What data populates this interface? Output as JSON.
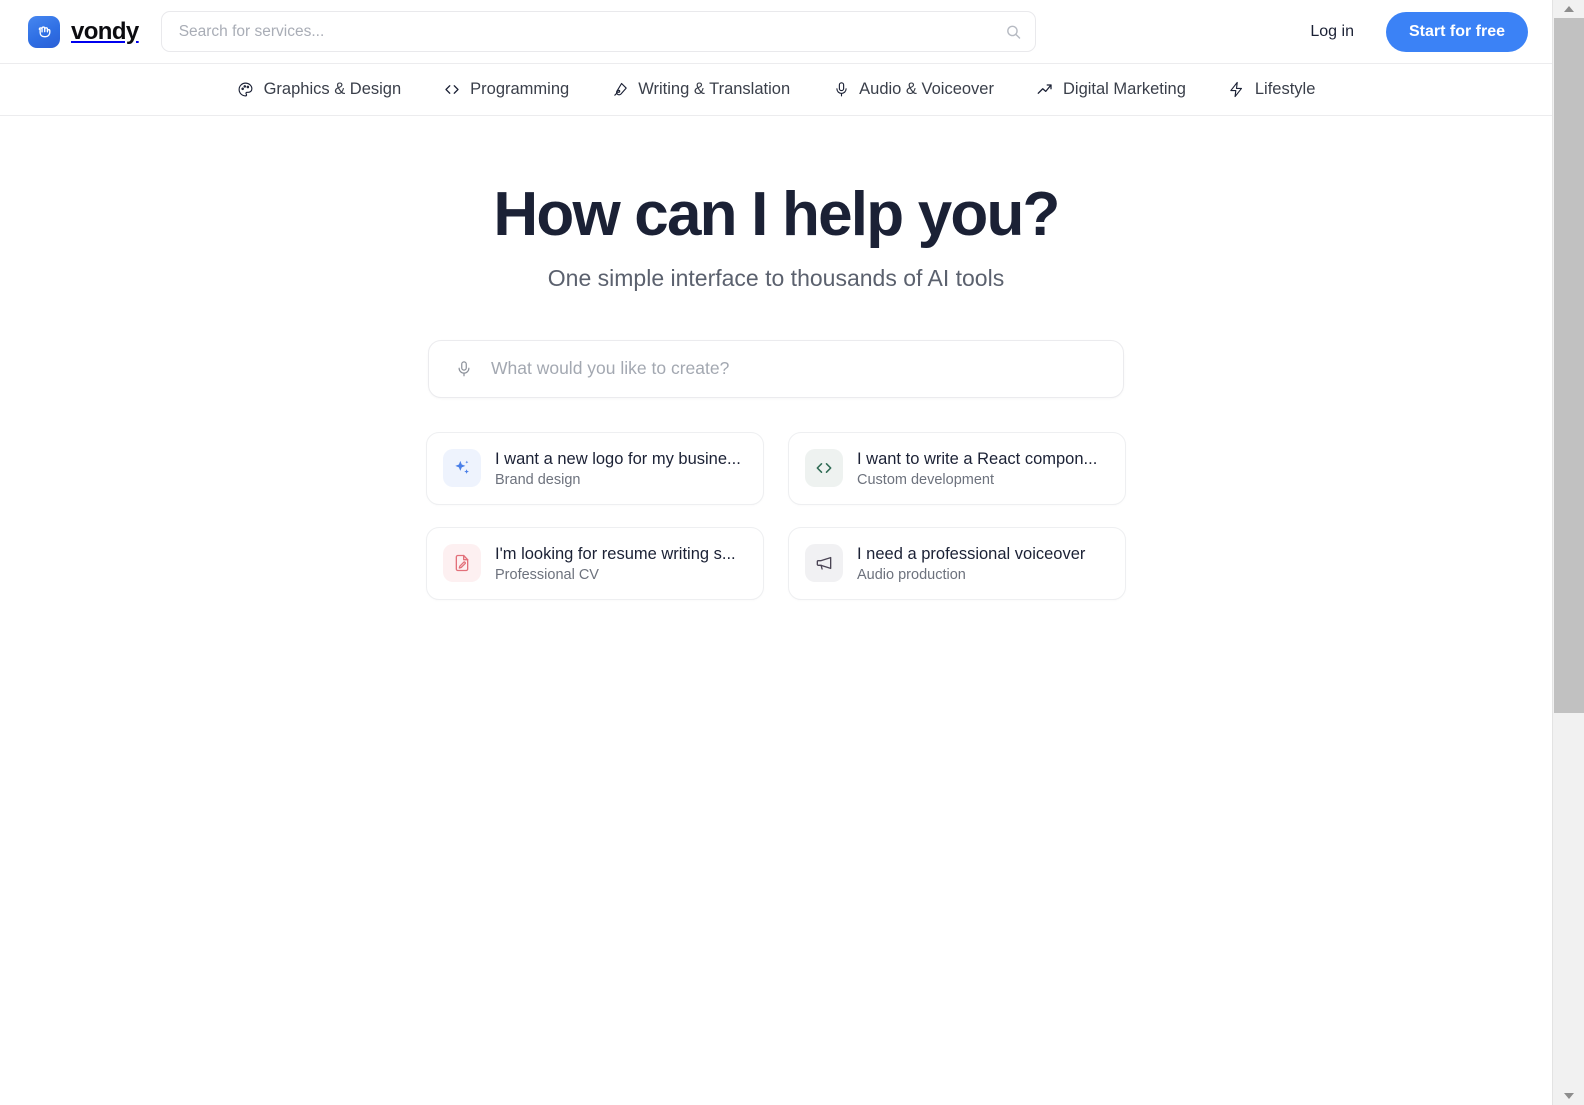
{
  "header": {
    "brand_name": "vondy",
    "brand_icon": "shaka-hand-icon",
    "search": {
      "placeholder": "Search for services...",
      "value": "",
      "icon": "search-icon"
    },
    "login_label": "Log in",
    "cta_label": "Start for free",
    "cta_color": "#3b82f6"
  },
  "nav": {
    "items": [
      {
        "label": "Graphics & Design",
        "icon": "palette-icon"
      },
      {
        "label": "Programming",
        "icon": "code-brackets-icon"
      },
      {
        "label": "Writing & Translation",
        "icon": "pen-nib-icon"
      },
      {
        "label": "Audio & Voiceover",
        "icon": "microphone-icon"
      },
      {
        "label": "Digital Marketing",
        "icon": "trending-up-icon"
      },
      {
        "label": "Lifestyle",
        "icon": "lightning-bolt-icon"
      }
    ]
  },
  "hero": {
    "title": "How can I help you?",
    "subtitle": "One simple interface to thousands of AI tools",
    "title_color": "#1b2135",
    "subtitle_color": "#5b616e"
  },
  "prompt": {
    "placeholder": "What would you like to create?",
    "value": "",
    "icon": "microphone-icon"
  },
  "suggestions": [
    {
      "title": "I want a new logo for my busine...",
      "subtitle": "Brand design",
      "icon": "sparkles-icon",
      "icon_color": "#4a7fe8",
      "icon_bg": "#eef3fd"
    },
    {
      "title": "I want to write a React compon...",
      "subtitle": "Custom development",
      "icon": "code-brackets-icon",
      "icon_color": "#2f6b54",
      "icon_bg": "#eef2f0"
    },
    {
      "title": "I'm looking for resume writing s...",
      "subtitle": "Professional CV",
      "icon": "document-edit-icon",
      "icon_color": "#e2707a",
      "icon_bg": "#fdf0f1"
    },
    {
      "title": "I need a professional voiceover",
      "subtitle": "Audio production",
      "icon": "megaphone-icon",
      "icon_color": "#4a4454",
      "icon_bg": "#f1f1f3"
    }
  ],
  "scrollbar": {
    "up_icon": "scroll-up-arrow-icon",
    "down_icon": "scroll-down-arrow-icon"
  }
}
